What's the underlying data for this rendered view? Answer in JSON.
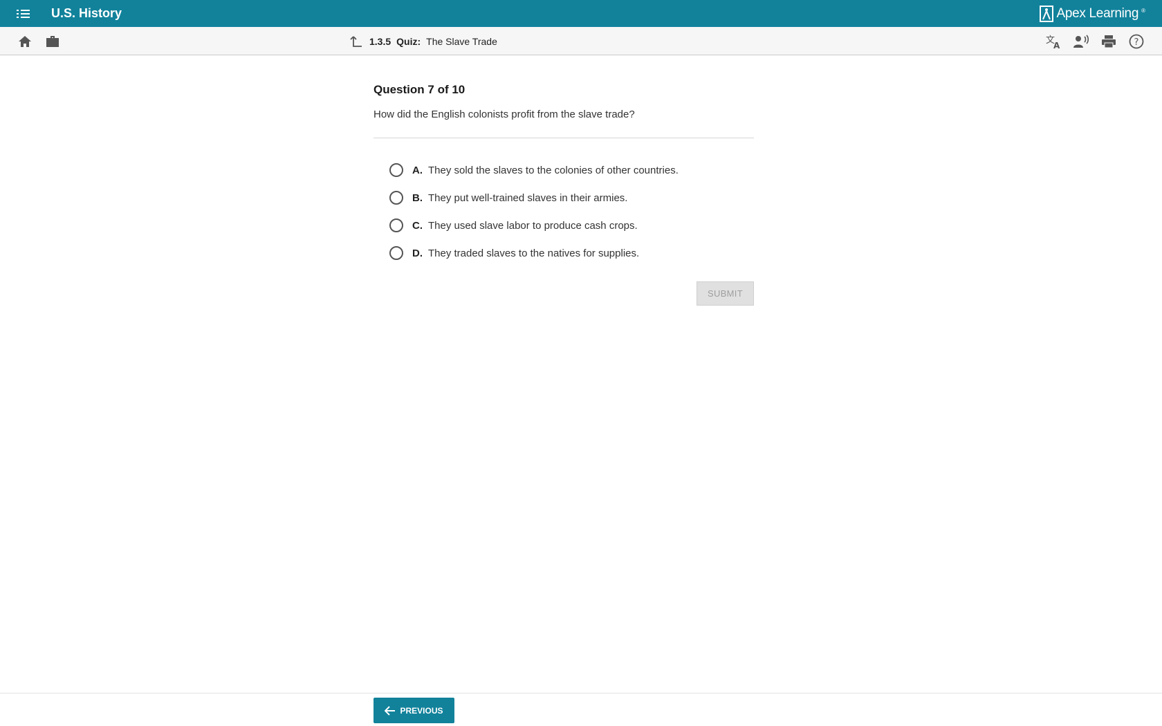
{
  "app": {
    "course_title": "U.S. History",
    "brand": "Apex Learning",
    "brand_mark": "®",
    "accent_color": "#12829b"
  },
  "toolbar": {
    "left_icons": [
      "home-icon",
      "briefcase-icon"
    ],
    "right_icons": [
      "translate-icon",
      "read-aloud-icon",
      "print-icon",
      "help-icon"
    ]
  },
  "breadcrumb": {
    "number": "1.3.5",
    "kind": "Quiz:",
    "title": "The Slave Trade"
  },
  "question": {
    "heading": "Question 7 of 10",
    "text": "How did the English colonists profit from the slave trade?",
    "choices": [
      {
        "letter": "A.",
        "text": "They sold the slaves to the colonies of other countries.",
        "selected": false
      },
      {
        "letter": "B.",
        "text": "They put well-trained slaves in their armies.",
        "selected": false
      },
      {
        "letter": "C.",
        "text": "They used slave labor to produce cash crops.",
        "selected": false
      },
      {
        "letter": "D.",
        "text": "They traded slaves to the natives for supplies.",
        "selected": false
      }
    ],
    "submit_label": "SUBMIT",
    "submit_enabled": false
  },
  "footer": {
    "previous_label": "PREVIOUS"
  }
}
